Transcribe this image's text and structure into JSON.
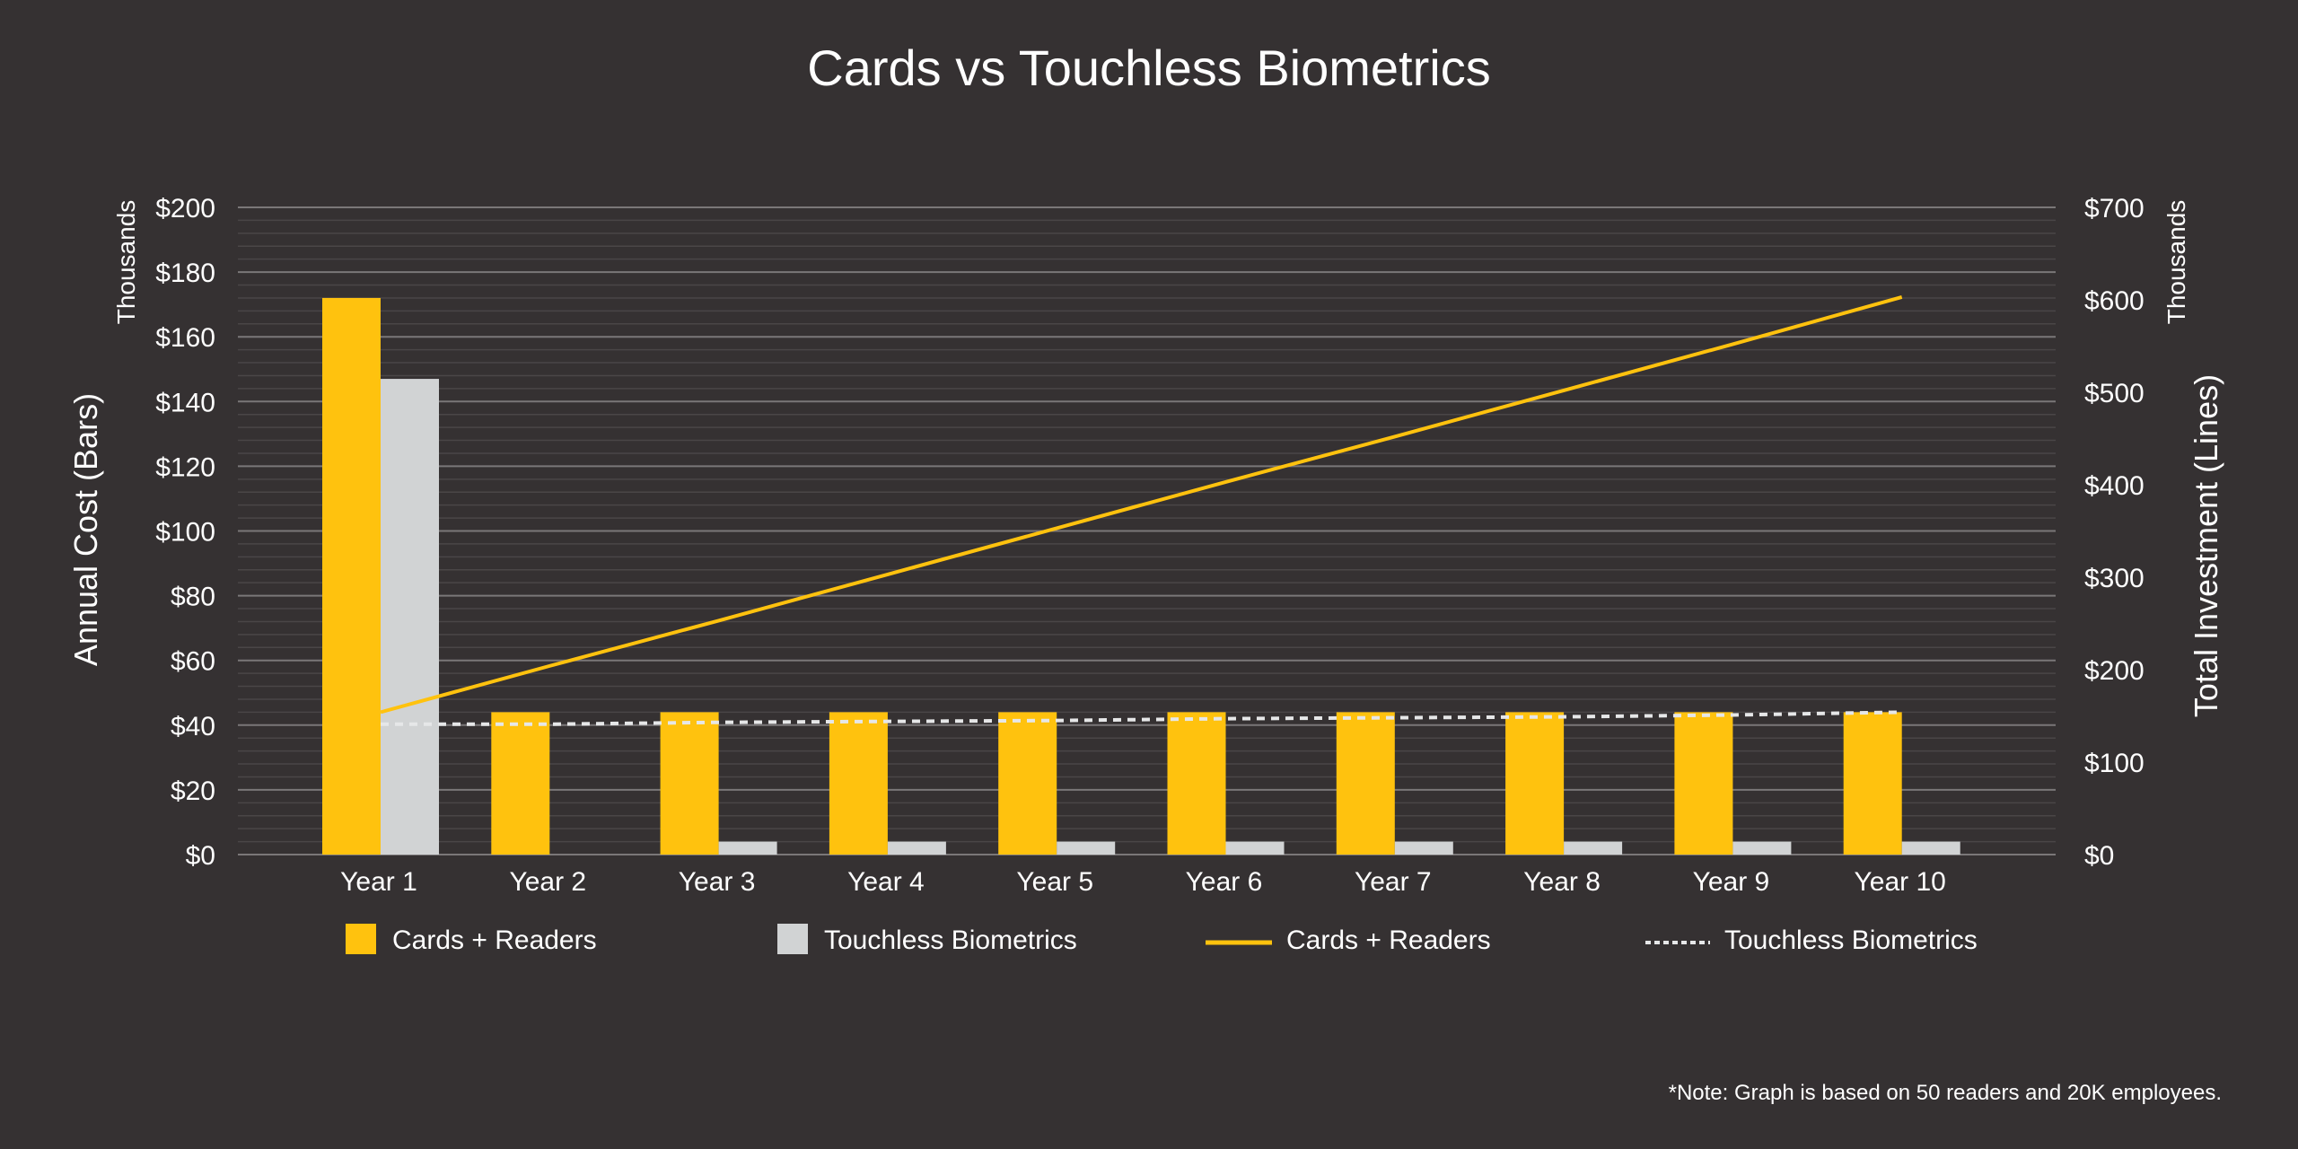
{
  "chart_data": {
    "type": "bar",
    "title": "Cards vs Touchless Biometrics",
    "categories": [
      "Year 1",
      "Year 2",
      "Year 3",
      "Year 4",
      "Year 5",
      "Year 6",
      "Year 7",
      "Year 8",
      "Year 9",
      "Year 10"
    ],
    "bar_series": [
      {
        "name": "Cards + Readers",
        "axis": "left",
        "color": "#FFC20E",
        "values": [
          172,
          44,
          44,
          44,
          44,
          44,
          44,
          44,
          44,
          44
        ]
      },
      {
        "name": "Touchless Biometrics",
        "axis": "left",
        "color": "#D1D3D4",
        "values": [
          147,
          0,
          4,
          4,
          4,
          4,
          4,
          4,
          4,
          4
        ]
      }
    ],
    "line_series": [
      {
        "name": "Cards + Readers",
        "axis": "right",
        "color": "#FFC20E",
        "style": "solid",
        "values": [
          154,
          204,
          253,
          303,
          353,
          403,
          452,
          502,
          552,
          603
        ]
      },
      {
        "name": "Touchless Biometrics",
        "axis": "right",
        "color": "#E6E7E8",
        "style": "dotted",
        "values": [
          141,
          141,
          143,
          144,
          145,
          147,
          148,
          149,
          151,
          154
        ]
      }
    ],
    "left_axis": {
      "label": "Annual Cost (Bars)",
      "unit": "Thousands",
      "ylim": [
        0,
        200
      ],
      "ticks": [
        "$0",
        "$20",
        "$40",
        "$60",
        "$80",
        "$100",
        "$120",
        "$140",
        "$160",
        "$180",
        "$200"
      ],
      "tick_values": [
        0,
        20,
        40,
        60,
        80,
        100,
        120,
        140,
        160,
        180,
        200
      ]
    },
    "right_axis": {
      "label": "Total Investment (Lines)",
      "unit": "Thousands",
      "ylim": [
        0,
        700
      ],
      "ticks": [
        "$0",
        "$100",
        "$200",
        "$300",
        "$400",
        "$500",
        "$600",
        "$700"
      ],
      "tick_values": [
        0,
        100,
        200,
        300,
        400,
        500,
        600,
        700
      ]
    },
    "grid": true,
    "legend": {
      "position": "bottom",
      "items": [
        {
          "label": "Cards + Readers",
          "kind": "bar",
          "color": "#FFC20E"
        },
        {
          "label": "Touchless Biometrics",
          "kind": "bar",
          "color": "#D1D3D4"
        },
        {
          "label": "Cards + Readers",
          "kind": "line",
          "color": "#FFC20E"
        },
        {
          "label": "Touchless Biometrics",
          "kind": "dotted",
          "color": "#E6E7E8"
        }
      ]
    },
    "note": "*Note: Graph is based on 50 readers and 20K employees."
  }
}
